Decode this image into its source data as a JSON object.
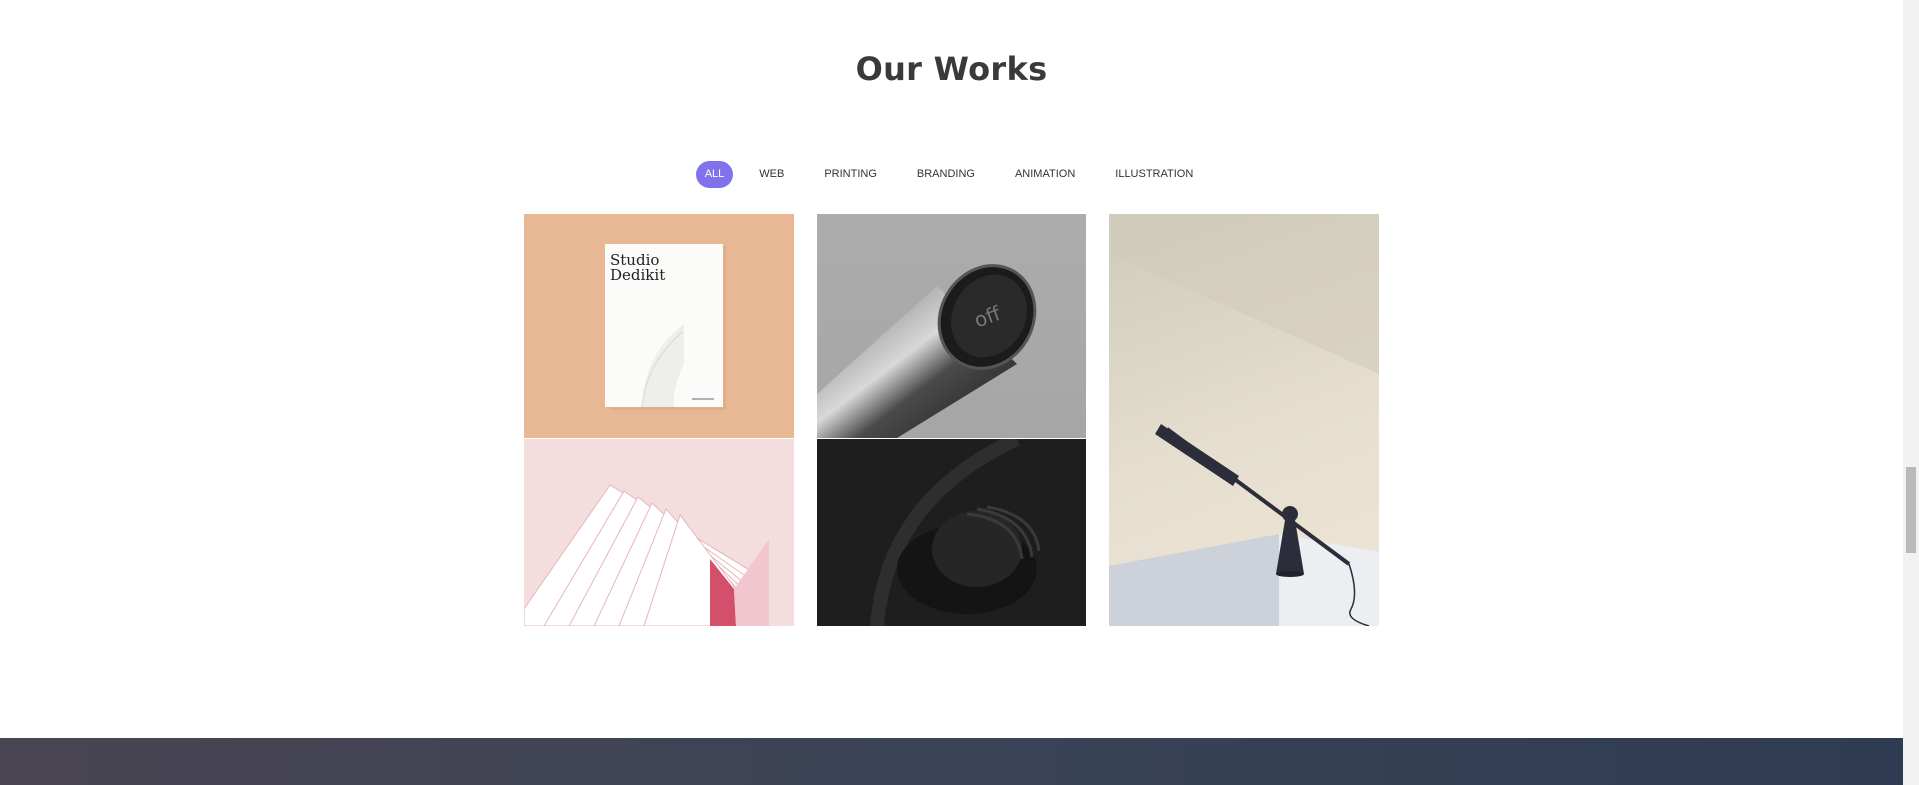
{
  "section": {
    "title": "Our Works"
  },
  "filters": [
    {
      "label": "ALL",
      "active": true
    },
    {
      "label": "WEB",
      "active": false
    },
    {
      "label": "PRINTING",
      "active": false
    },
    {
      "label": "BRANDING",
      "active": false
    },
    {
      "label": "ANIMATION",
      "active": false
    },
    {
      "label": "ILLUSTRATION",
      "active": false
    }
  ],
  "portfolio": {
    "notebook": {
      "brand_line1": "Studio",
      "brand_line2": "Dedikit"
    },
    "tube": {
      "label": "off"
    }
  },
  "colors": {
    "accent": "#8072ea"
  }
}
